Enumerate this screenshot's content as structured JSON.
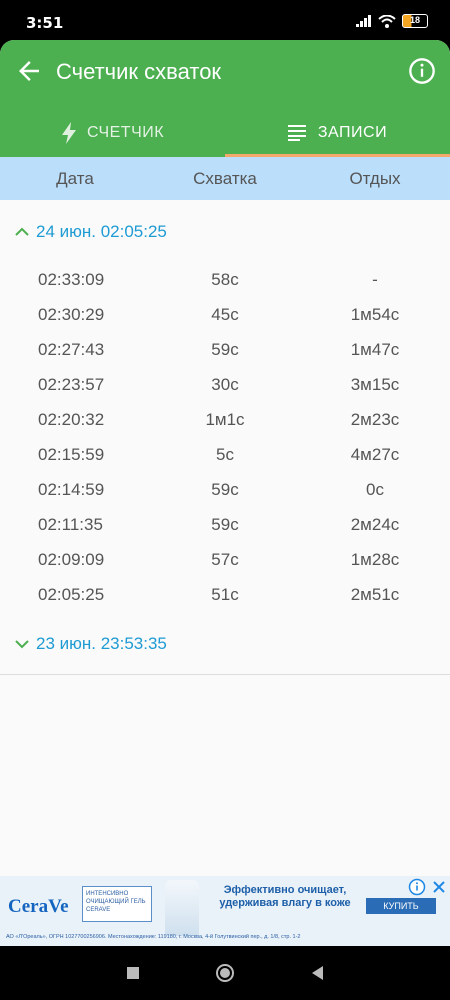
{
  "status": {
    "time": "3:51",
    "battery": "18"
  },
  "appbar": {
    "title": "Счетчик схваток",
    "back_icon": "arrow-left-icon",
    "info_icon": "info-icon"
  },
  "tabs": [
    {
      "label": "СЧЕТЧИК",
      "icon": "lightning-icon",
      "selected": false
    },
    {
      "label": "ЗАПИСИ",
      "icon": "list-lines-icon",
      "selected": true
    }
  ],
  "columns": [
    "Дата",
    "Схватка",
    "Отдых"
  ],
  "groups": [
    {
      "label": "24 июн. 02:05:25",
      "expanded": true,
      "rows": [
        {
          "time": "02:33:09",
          "contraction": "58с",
          "rest": "-"
        },
        {
          "time": "02:30:29",
          "contraction": "45с",
          "rest": "1м54с"
        },
        {
          "time": "02:27:43",
          "contraction": "59с",
          "rest": "1м47с"
        },
        {
          "time": "02:23:57",
          "contraction": "30с",
          "rest": "3м15с"
        },
        {
          "time": "02:20:32",
          "contraction": "1м1с",
          "rest": "2м23с"
        },
        {
          "time": "02:15:59",
          "contraction": "5с",
          "rest": "4м27с"
        },
        {
          "time": "02:14:59",
          "contraction": "59с",
          "rest": "0с"
        },
        {
          "time": "02:11:35",
          "contraction": "59с",
          "rest": "2м24с"
        },
        {
          "time": "02:09:09",
          "contraction": "57с",
          "rest": "1м28с"
        },
        {
          "time": "02:05:25",
          "contraction": "51с",
          "rest": "2м51с"
        }
      ]
    },
    {
      "label": "23 июн. 23:53:35",
      "expanded": false
    }
  ],
  "ad": {
    "brand": "CeraVe",
    "box_text": "ИНТЕНСИВНО ОЧИЩАЮЩИЙ ГЕЛЬ CERAVE",
    "headline": "Эффективно очищает, удерживая влагу в коже",
    "cta": "КУПИТЬ",
    "legal": "АО «Л'Ореаль», ОГРН 1027700256906. Местонахождение: 119180, г. Москва, 4-й Голутвинский пер., д. 1/8, стр. 1-2"
  },
  "colors": {
    "primary": "#4caf50",
    "tab_indicator": "#f5a86b",
    "header_bg": "#bbdefb",
    "group_label": "#1e9bd3"
  }
}
